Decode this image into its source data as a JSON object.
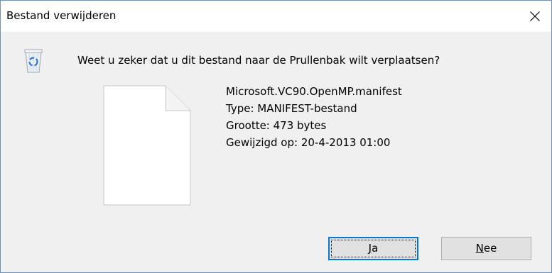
{
  "window": {
    "title": "Bestand verwijderen",
    "close_icon": "close-icon"
  },
  "dialog": {
    "icon": "recycle-bin-icon",
    "prompt": "Weet u zeker dat u dit bestand naar de Prullenbak wilt verplaatsen?",
    "file_icon": "document-icon",
    "file": {
      "name": "Microsoft.VC90.OpenMP.manifest",
      "type": "Type: MANIFEST-bestand",
      "size": "Grootte: 473 bytes",
      "modified": "Gewijzigd op: 20-4-2013 01:00"
    },
    "buttons": {
      "yes_mnemonic": "J",
      "yes_rest": "a",
      "no_mnemonic": "N",
      "no_rest": "ee"
    }
  },
  "colors": {
    "accent": "#0078d7",
    "background": "#f0f0f0",
    "titlebar": "#ffffff"
  }
}
